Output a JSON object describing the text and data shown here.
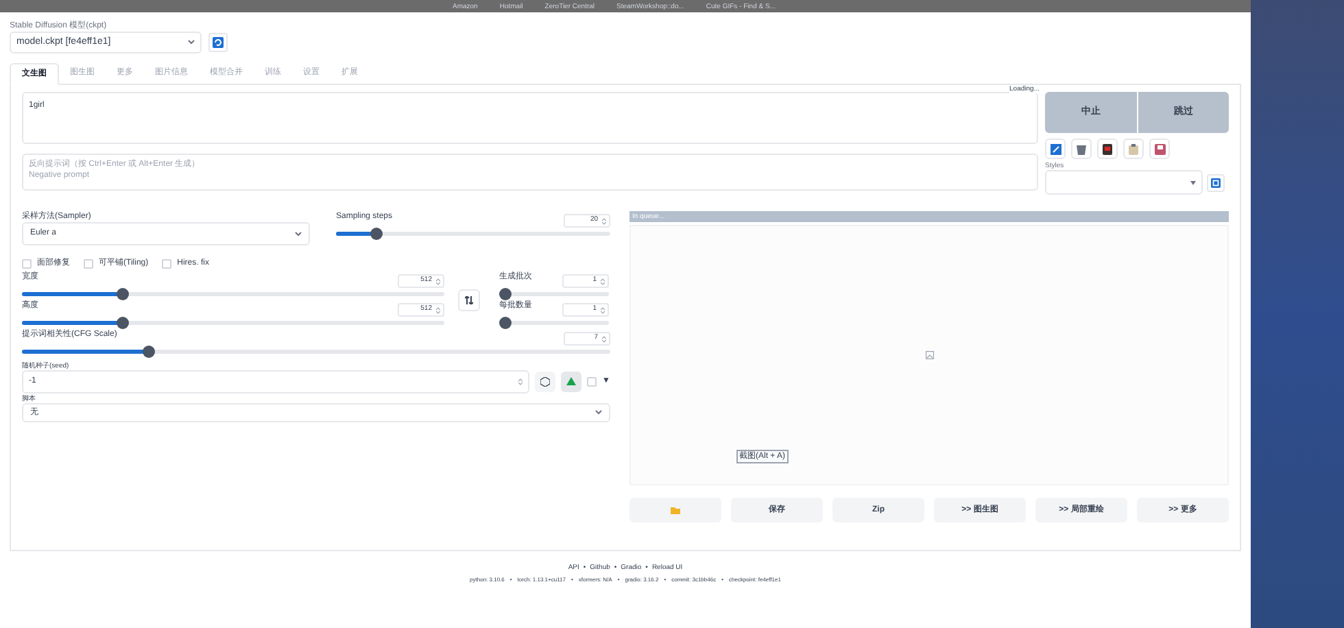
{
  "bookmarks": [
    {
      "label": "Amazon"
    },
    {
      "label": "Hotmail"
    },
    {
      "label": "ZeroTier Central"
    },
    {
      "label": "SteamWorkshop::do..."
    },
    {
      "label": "Cute GIFs - Find & S..."
    }
  ],
  "model": {
    "label": "Stable Diffusion 模型(ckpt)",
    "value": "model.ckpt [fe4eff1e1]"
  },
  "tabs": [
    {
      "label": "文生图",
      "selected": true
    },
    {
      "label": "图生图",
      "selected": false
    },
    {
      "label": "更多",
      "selected": false
    },
    {
      "label": "图片信息",
      "selected": false
    },
    {
      "label": "模型合并",
      "selected": false
    },
    {
      "label": "训练",
      "selected": false
    },
    {
      "label": "设置",
      "selected": false
    },
    {
      "label": "扩展",
      "selected": false
    }
  ],
  "prompt": {
    "value": "1girl",
    "status": "Loading..."
  },
  "negative_prompt": {
    "placeholder": "反向提示词（按 Ctrl+Enter 或 Alt+Enter 生成）\nNegative prompt"
  },
  "actions": [
    "中止",
    "跳过"
  ],
  "styles": {
    "label": "Styles"
  },
  "sampler": {
    "label": "采样方法(Sampler)",
    "value": "Euler a"
  },
  "sampling_steps": {
    "label": "Sampling steps",
    "value": "20",
    "level": 0.13
  },
  "checkboxes": [
    {
      "label": "面部修复",
      "checked": false
    },
    {
      "label": "可平铺(Tiling)",
      "checked": false
    },
    {
      "label": "Hires. fix",
      "checked": false
    }
  ],
  "width": {
    "label": "宽度",
    "value": "512",
    "level": 0.23
  },
  "height": {
    "label": "高度",
    "value": "512",
    "level": 0.23
  },
  "batch_count": {
    "label": "生成批次",
    "value": "1",
    "level": 0
  },
  "batch_size": {
    "label": "每批数量",
    "value": "1",
    "level": 0
  },
  "cfg_scale": {
    "label": "提示词相关性(CFG Scale)",
    "value": "7",
    "level": 0.21
  },
  "seed": {
    "label": "随机种子(seed)",
    "value": "-1",
    "extra_checked": false,
    "toggle": "▼"
  },
  "script": {
    "label": "脚本",
    "value": "无"
  },
  "output": {
    "status": "In queue...",
    "tooltip": "截图(Alt + A)",
    "buttons": [
      {
        "kind": "folder"
      },
      {
        "kind": "text",
        "label": "保存"
      },
      {
        "kind": "text",
        "label": "Zip"
      },
      {
        "kind": "text",
        "label": ">> 图生图"
      },
      {
        "kind": "text",
        "label": ">> 局部重绘"
      },
      {
        "kind": "text",
        "label": ">> 更多"
      }
    ]
  },
  "footer": {
    "separator": "•",
    "links": [
      "API",
      "Github",
      "Gradio",
      "Reload UI"
    ],
    "versions": [
      "python: 3.10.6",
      "torch: 1.13.1+cu117",
      "xformers: N/A",
      "gradio: 3.16.2",
      "commit: 3c1bb46c",
      "checkpoint: fe4eff1e1"
    ]
  }
}
